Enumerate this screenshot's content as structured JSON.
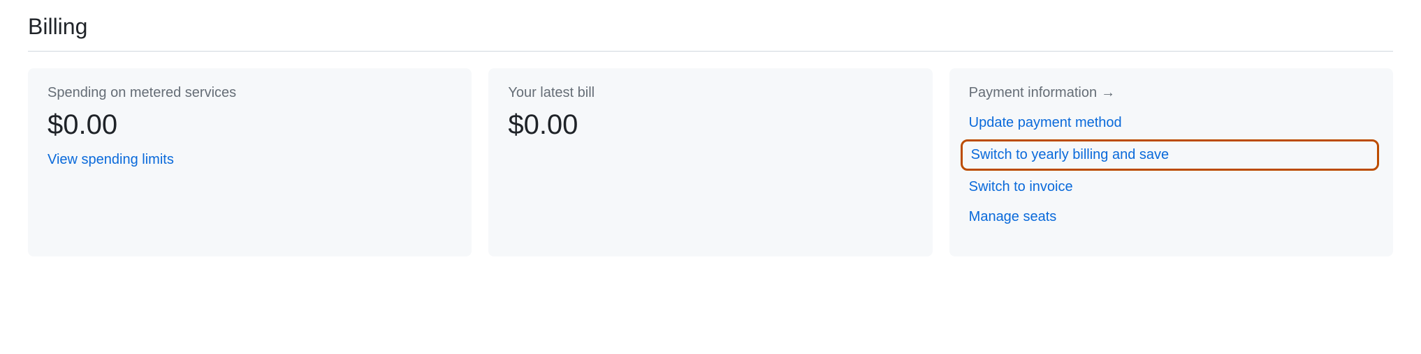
{
  "page": {
    "title": "Billing"
  },
  "cards": {
    "spending": {
      "title": "Spending on metered services",
      "amount": "$0.00",
      "link": "View spending limits"
    },
    "bill": {
      "title": "Your latest bill",
      "amount": "$0.00"
    },
    "payment": {
      "title": "Payment information",
      "arrow": "→",
      "links": {
        "update": "Update payment method",
        "yearly": "Switch to yearly billing and save",
        "invoice": "Switch to invoice",
        "seats": "Manage seats"
      }
    }
  }
}
